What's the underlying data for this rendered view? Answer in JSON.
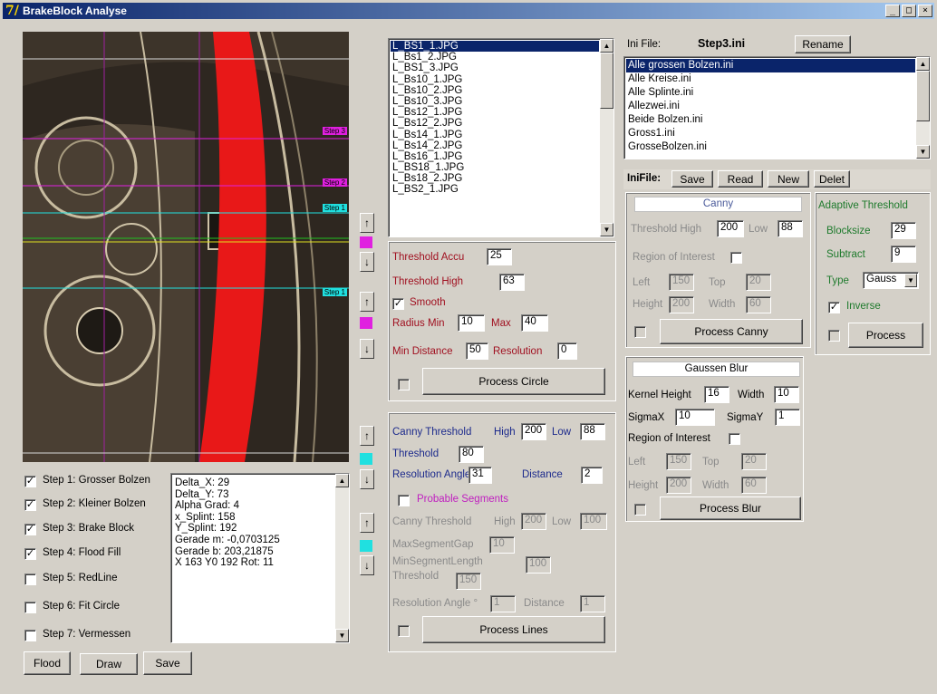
{
  "window": {
    "title": "BrakeBlock Analyse",
    "app_icon_glyph": "7/",
    "buttons": [
      "_",
      "□",
      "×"
    ]
  },
  "image_view": {
    "step_tags": [
      "Step 3",
      "Step 2",
      "Step 1",
      "Step 1"
    ]
  },
  "file_list": {
    "items": [
      "L_BS1_1.JPG",
      "L_Bs1_2.JPG",
      "L_BS1_3.JPG",
      "L_Bs10_1.JPG",
      "L_Bs10_2.JPG",
      "L_Bs10_3.JPG",
      "L_Bs12_1.JPG",
      "L_Bs12_2.JPG",
      "L_Bs14_1.JPG",
      "L_Bs14_2.JPG",
      "L_Bs16_1.JPG",
      "L_BS18_1.JPG",
      "L_Bs18_2.JPG",
      "L_BS2_1.JPG"
    ],
    "selected": 0
  },
  "steps": [
    {
      "label": "Step 1: Grosser Bolzen",
      "checked": true
    },
    {
      "label": "Step 2: Kleiner Bolzen",
      "checked": true
    },
    {
      "label": "Step 3: Brake Block",
      "checked": true
    },
    {
      "label": "Step 4: Flood Fill",
      "checked": true
    },
    {
      "label": "Step 5: RedLine",
      "checked": false
    },
    {
      "label": "Step 6: Fit Circle",
      "checked": false
    },
    {
      "label": "Step 7: Vermessen",
      "checked": false
    }
  ],
  "output_text": [
    "Delta_X: 29",
    "Delta_Y: 73",
    "Alpha Grad: 4",
    "x_Splint: 158",
    "Y_Splint: 192",
    "Gerade m: -0,0703125",
    "Gerade b: 203,21875",
    "X 163  Y0 192  Rot: 11"
  ],
  "bottom_buttons": {
    "flood": "Flood",
    "draw": "Draw",
    "save": "Save"
  },
  "circle": {
    "threshold_accu_label": "Threshold Accu",
    "threshold_accu": "25",
    "threshold_high_label": "Threshold High",
    "threshold_high": "63",
    "smooth_label": "Smooth",
    "smooth_checked": true,
    "radius_min_label": "Radius Min",
    "radius_min": "10",
    "max_label": "Max",
    "max": "40",
    "min_distance_label": "Min Distance",
    "min_distance": "50",
    "resolution_label": "Resolution",
    "resolution": "0",
    "process_button": "Process Circle"
  },
  "lines": {
    "canny_label": "Canny Threshold",
    "high_label": "High",
    "high": "200",
    "low_label": "Low",
    "low": "88",
    "threshold_label": "Threshold",
    "threshold": "80",
    "resolution_angle_label": "Resolution Angle °",
    "resolution_angle": "31",
    "distance_label": "Distance",
    "distance": "2",
    "probable_label": "Probable Segments",
    "probable_checked": false,
    "p_canny_label": "Canny Threshold",
    "p_high_label": "High",
    "p_high": "200",
    "p_low_label": "Low",
    "p_low": "100",
    "max_gap_label": "MaxSegmentGap",
    "max_gap": "10",
    "min_length_label": "MinSegmentLength",
    "min_length": "100",
    "p_threshold_label": "Threshold",
    "p_threshold": "150",
    "p_res_label": "Resolution Angle °",
    "p_res": "1",
    "p_distance_label": "Distance",
    "p_distance": "1",
    "process_button": "Process Lines"
  },
  "ini": {
    "file_label": "Ini File:",
    "file_name": "Step3.ini",
    "rename_button": "Rename",
    "items": [
      "Alle grossen Bolzen.ini",
      "Alle Kreise.ini",
      "Alle Splinte.ini",
      "Allezwei.ini",
      "Beide Bolzen.ini",
      "Gross1.ini",
      "GrosseBolzen.ini"
    ],
    "selected": 0,
    "inifile_label": "IniFile:",
    "save": "Save",
    "read": "Read",
    "new": "New",
    "delete": "Delet"
  },
  "canny": {
    "title": "Canny",
    "threshold_high_label": "Threshold High",
    "high": "200",
    "low_label": "Low",
    "low": "88",
    "roi_label": "Region of Interest",
    "roi_checked": false,
    "left_label": "Left",
    "left": "150",
    "top_label": "Top",
    "top": "20",
    "height_label": "Height",
    "height": "200",
    "width_label": "Width",
    "width": "60",
    "process_button": "Process Canny"
  },
  "adaptive": {
    "title": "Adaptive Threshold",
    "blocksize_label": "Blocksize",
    "blocksize": "29",
    "subtract_label": "Subtract",
    "subtract": "9",
    "type_label": "Type",
    "type_value": "Gauss",
    "inverse_label": "Inverse",
    "inverse_checked": true,
    "process_button": "Process"
  },
  "gauss": {
    "title": "Gaussen Blur",
    "kernel_height_label": "Kernel Height",
    "kernel_height": "16",
    "width_label": "Width",
    "width": "10",
    "sigmax_label": "SigmaX",
    "sigmax": "10",
    "sigmay_label": "SigmaY",
    "sigmay": "1",
    "roi_label": "Region of Interest",
    "roi_checked": false,
    "left_label": "Left",
    "left": "150",
    "top_label": "Top",
    "top": "20",
    "height_label": "Height",
    "height": "200",
    "width2_label": "Width",
    "width2": "60",
    "process_button": "Process Blur"
  },
  "colors": {
    "magenta": "#e020e0",
    "cyan": "#20e0e0",
    "red": "#e81818"
  }
}
